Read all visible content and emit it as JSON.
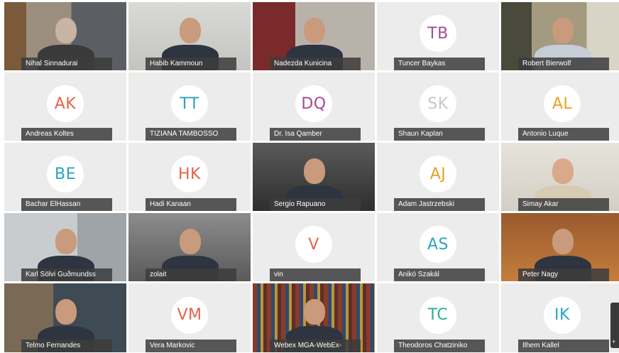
{
  "meeting": {
    "app": "Webex",
    "participants": [
      {
        "name": "Nihal Sinnadurai",
        "type": "video",
        "scene": "office-shelves"
      },
      {
        "name": "Habib Kammoun",
        "type": "video",
        "scene": "plain-wall"
      },
      {
        "name": "Nadezda Kunicina",
        "type": "video",
        "scene": "red-curtain"
      },
      {
        "name": "Tuncer Baykas",
        "type": "avatar",
        "initials": "TB",
        "color": "#a54a97"
      },
      {
        "name": "Robert Bierwolf",
        "type": "video",
        "scene": "living-room"
      },
      {
        "name": "Andreas Koltes",
        "type": "avatar",
        "initials": "AK",
        "color": "#e5634a"
      },
      {
        "name": "TIZIANA TAMBOSSO",
        "type": "avatar",
        "initials": "TT",
        "color": "#2aa3c2"
      },
      {
        "name": "Dr. Isa Qamber",
        "type": "avatar",
        "initials": "DQ",
        "color": "#a54a97"
      },
      {
        "name": "Shaun Kaplan",
        "type": "avatar",
        "initials": "SK",
        "color": "#c8c8c8"
      },
      {
        "name": "Antonio Luque",
        "type": "avatar",
        "initials": "AL",
        "color": "#e8a220"
      },
      {
        "name": "Bachar ElHassan",
        "type": "avatar",
        "initials": "BE",
        "color": "#2aa3c2"
      },
      {
        "name": "Hadi Kanaan",
        "type": "avatar",
        "initials": "HK",
        "color": "#e5634a"
      },
      {
        "name": "Sergio Rapuano",
        "type": "video",
        "scene": "dark-room"
      },
      {
        "name": "Adam Jastrzebski",
        "type": "avatar",
        "initials": "AJ",
        "color": "#e8a220"
      },
      {
        "name": "Simay Akar",
        "type": "video",
        "scene": "bright-wall"
      },
      {
        "name": "Karl Sölvi Guðmundss",
        "type": "video",
        "scene": "whiteboard"
      },
      {
        "name": "zolait",
        "type": "video",
        "scene": "grey-room"
      },
      {
        "name": "vin",
        "type": "avatar",
        "initials": "V",
        "color": "#e5634a"
      },
      {
        "name": "Anikó Szakál",
        "type": "avatar",
        "initials": "AS",
        "color": "#2aa3c2"
      },
      {
        "name": "Peter Nagy",
        "type": "video",
        "scene": "wood-room"
      },
      {
        "name": "Telmo Fernandes",
        "type": "video",
        "scene": "warm-room"
      },
      {
        "name": "Vera Markovic",
        "type": "avatar",
        "initials": "VM",
        "color": "#e5634a"
      },
      {
        "name": "Webex MGA-WebEx-",
        "type": "video",
        "scene": "bookshelf"
      },
      {
        "name": "Theodoros Chatziniko",
        "type": "avatar",
        "initials": "TC",
        "color": "#2bb08d"
      },
      {
        "name": "Ilhem Kallel",
        "type": "avatar",
        "initials": "IK",
        "color": "#2aa3c2"
      }
    ]
  }
}
